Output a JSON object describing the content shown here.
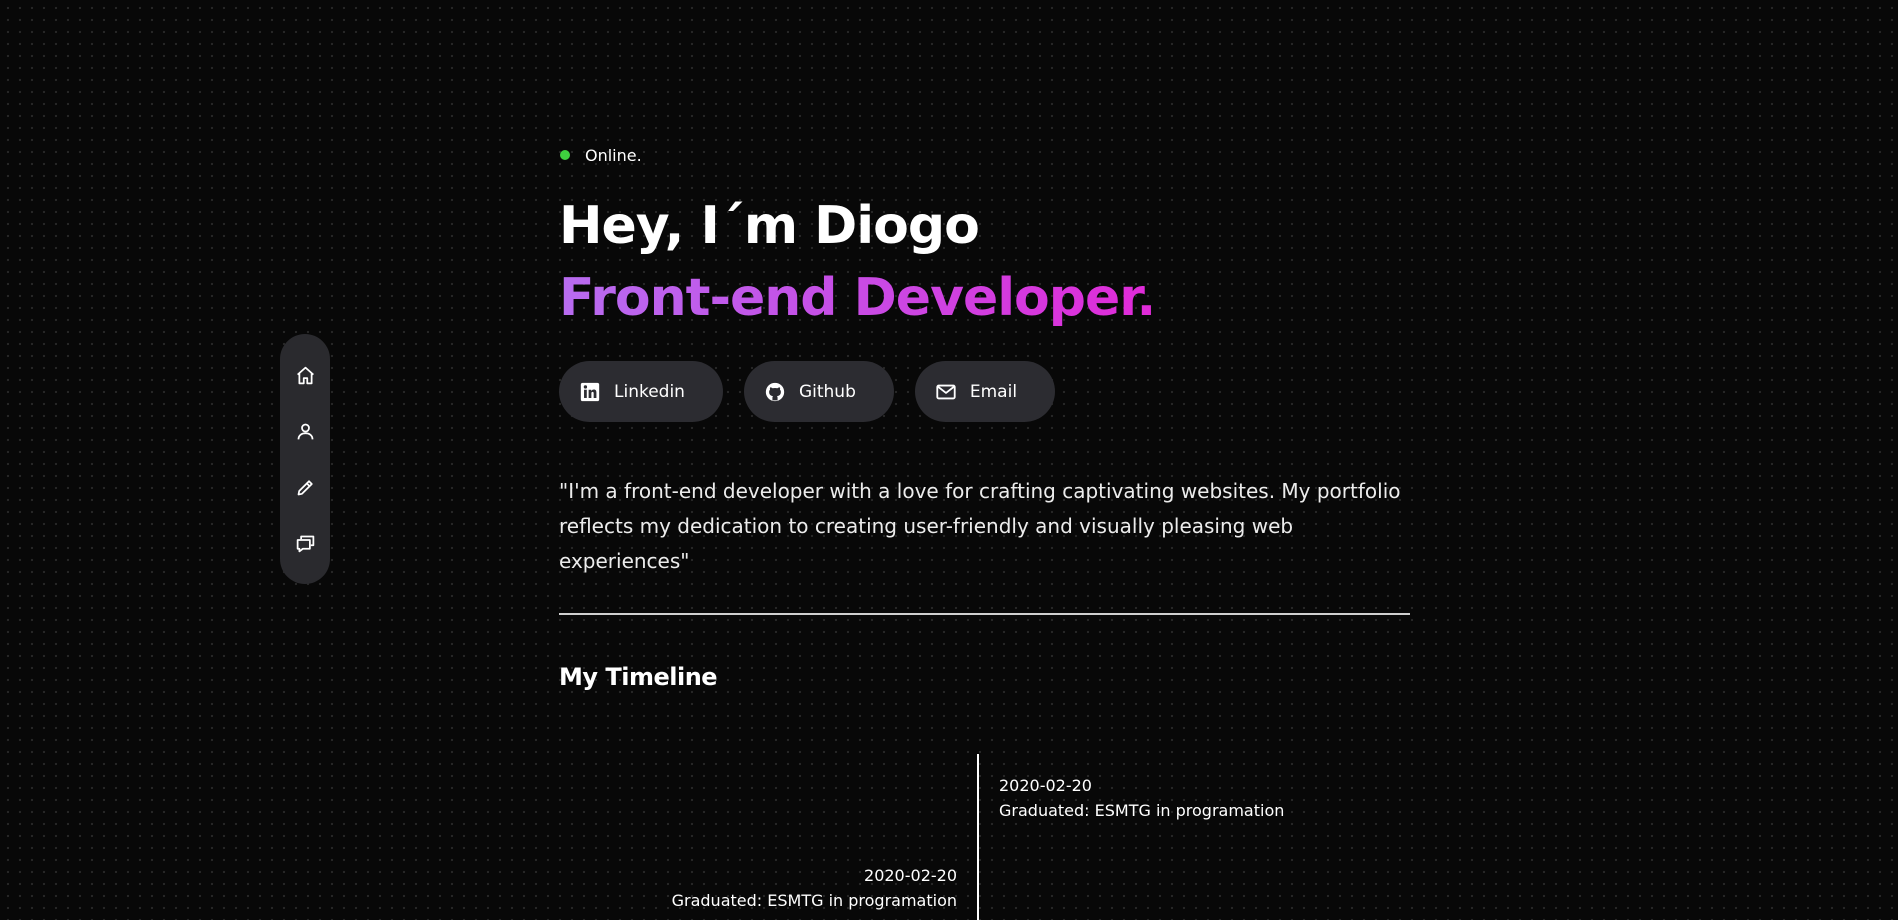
{
  "status": {
    "label": "Online.",
    "color": "#3fd13f"
  },
  "hero": {
    "headline": "Hey, I´m Diogo",
    "role": "Front-end Developer.",
    "role_gradient": [
      "#b86cf0",
      "#e02ad8"
    ]
  },
  "socials": [
    {
      "label": "Linkedin",
      "icon": "linkedin-icon"
    },
    {
      "label": "Github",
      "icon": "github-icon"
    },
    {
      "label": "Email",
      "icon": "mail-icon"
    }
  ],
  "quote": "\"I'm a front-end developer with a love for crafting captivating websites. My portfolio reflects my dedication to creating user-friendly and visually pleasing web experiences\"",
  "side_nav": [
    {
      "icon": "home-icon"
    },
    {
      "icon": "user-icon"
    },
    {
      "icon": "pencil-icon"
    },
    {
      "icon": "chat-icon"
    }
  ],
  "timeline": {
    "title": "My Timeline",
    "entries": [
      {
        "date": "2020-02-20",
        "text": "Graduated: ESMTG in programation",
        "side": "right"
      },
      {
        "date": "2020-02-20",
        "text": "Graduated: ESMTG in programation",
        "side": "left"
      }
    ]
  },
  "colors": {
    "background": "#080808",
    "nav_background": "#2a2a2e",
    "button_background": "#2c2c31"
  }
}
